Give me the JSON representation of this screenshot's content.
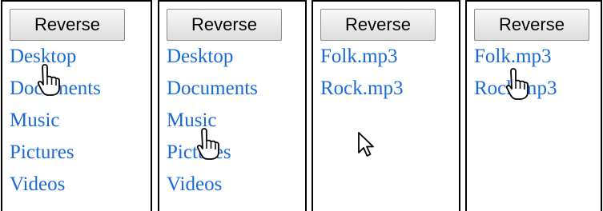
{
  "panels": [
    {
      "button_label": "Reverse",
      "items": [
        "Desktop",
        "Documents",
        "Music",
        "Pictures",
        "Videos"
      ]
    },
    {
      "button_label": "Reverse",
      "items": [
        "Desktop",
        "Documents",
        "Music",
        "Pictures",
        "Videos"
      ]
    },
    {
      "button_label": "Reverse",
      "items": [
        "Folk.mp3",
        "Rock.mp3"
      ]
    },
    {
      "button_label": "Reverse",
      "items": [
        "Folk.mp3",
        "Rock.mp3"
      ]
    }
  ],
  "cursors": {
    "panel1": "hand-pointer-icon",
    "panel2": "hand-pointer-icon",
    "panel3": "arrow-pointer-icon",
    "panel4": "hand-pointer-icon"
  },
  "colors": {
    "link": "#1a6ad6",
    "border": "#000000",
    "button_border": "#8a8a8a"
  }
}
